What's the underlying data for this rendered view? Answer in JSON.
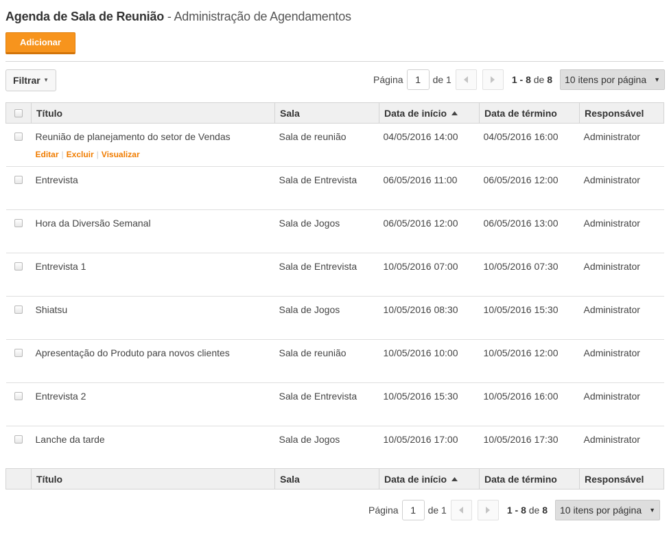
{
  "header": {
    "title": "Agenda de Sala de Reunião",
    "separator": " - ",
    "subtitle": "Administração de Agendamentos"
  },
  "toolbar": {
    "add_label": "Adicionar",
    "filter_label": "Filtrar"
  },
  "pagination": {
    "page_label": "Página",
    "page_value": "1",
    "of_label": "de 1",
    "range": "1 - 8",
    "range_of": "de",
    "total": "8",
    "per_page": "10 itens por página"
  },
  "table": {
    "columns": {
      "title": "Título",
      "room": "Sala",
      "start": "Data de início",
      "end": "Data de término",
      "owner": "Responsável"
    },
    "row_actions": {
      "edit": "Editar",
      "delete": "Excluir",
      "view": "Visualizar"
    },
    "rows": [
      {
        "title": "Reunião de planejamento do setor de Vendas",
        "room": "Sala de reunião",
        "start": "04/05/2016 14:00",
        "end": "04/05/2016 16:00",
        "owner": "Administrator"
      },
      {
        "title": "Entrevista",
        "room": "Sala de Entrevista",
        "start": "06/05/2016 11:00",
        "end": "06/05/2016 12:00",
        "owner": "Administrator"
      },
      {
        "title": "Hora da Diversão Semanal",
        "room": "Sala de Jogos",
        "start": "06/05/2016 12:00",
        "end": "06/05/2016 13:00",
        "owner": "Administrator"
      },
      {
        "title": "Entrevista 1",
        "room": "Sala de Entrevista",
        "start": "10/05/2016 07:00",
        "end": "10/05/2016 07:30",
        "owner": "Administrator"
      },
      {
        "title": "Shiatsu",
        "room": "Sala de Jogos",
        "start": "10/05/2016 08:30",
        "end": "10/05/2016 15:30",
        "owner": "Administrator"
      },
      {
        "title": "Apresentação do Produto para novos clientes",
        "room": "Sala de reunião",
        "start": "10/05/2016 10:00",
        "end": "10/05/2016 12:00",
        "owner": "Administrator"
      },
      {
        "title": "Entrevista 2",
        "room": "Sala de Entrevista",
        "start": "10/05/2016 15:30",
        "end": "10/05/2016 16:00",
        "owner": "Administrator"
      },
      {
        "title": "Lanche da tarde",
        "room": "Sala de Jogos",
        "start": "10/05/2016 17:00",
        "end": "10/05/2016 17:30",
        "owner": "Administrator"
      }
    ]
  },
  "colors": {
    "accent": "#f7941d",
    "link": "#f07c00"
  },
  "icons": {
    "sort": "sort-ascending-icon",
    "prev": "chevron-left-icon",
    "next": "chevron-right-icon",
    "caret": "caret-down-icon"
  }
}
